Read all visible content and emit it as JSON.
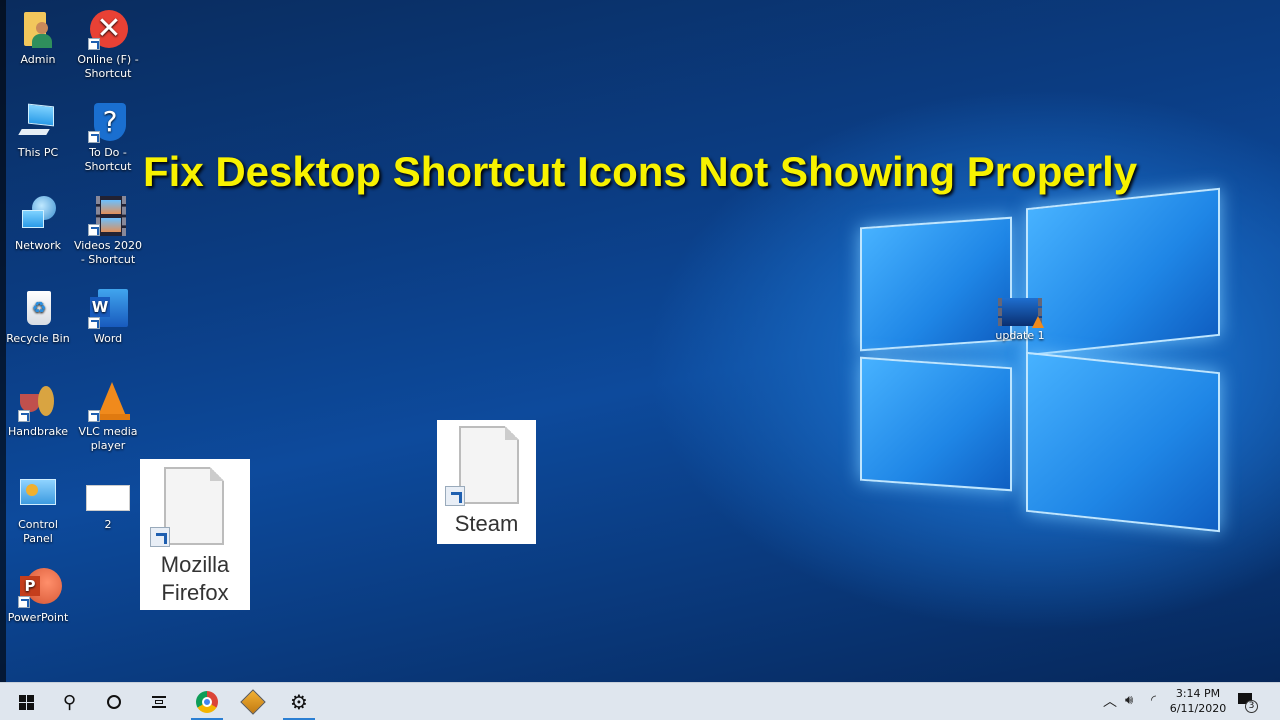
{
  "overlay_title": "Fix Desktop Shortcut Icons Not Showing Properly",
  "desktop_icons": [
    {
      "label": "Admin",
      "icon": "user-folder-icon",
      "shortcut": false
    },
    {
      "label": "Online (F) - Shortcut",
      "icon": "error-x-icon",
      "shortcut": true
    },
    {
      "label": "This PC",
      "icon": "computer-icon",
      "shortcut": false
    },
    {
      "label": "To Do - Shortcut",
      "icon": "question-shield-icon",
      "shortcut": true
    },
    {
      "label": "Network",
      "icon": "network-icon",
      "shortcut": false
    },
    {
      "label": "Videos 2020 - Shortcut",
      "icon": "film-strip-icon",
      "shortcut": true
    },
    {
      "label": "Recycle Bin",
      "icon": "recycle-bin-icon",
      "shortcut": false
    },
    {
      "label": "Word",
      "icon": "word-icon",
      "shortcut": true
    },
    {
      "label": "Handbrake",
      "icon": "handbrake-icon",
      "shortcut": true
    },
    {
      "label": "VLC media player",
      "icon": "vlc-cone-icon",
      "shortcut": true
    },
    {
      "label": "Control Panel",
      "icon": "control-panel-icon",
      "shortcut": false
    },
    {
      "label": "2",
      "icon": "image-thumbnail-icon",
      "shortcut": false
    },
    {
      "label": "PowerPoint",
      "icon": "powerpoint-icon",
      "shortcut": true
    },
    {
      "label": "update 1",
      "icon": "video-thumbnail-icon",
      "shortcut": false
    }
  ],
  "broken_shortcuts": [
    {
      "label": "Mozilla Firefox",
      "line1": "Mozilla",
      "line2": "Firefox",
      "icon": "blank-document-icon"
    },
    {
      "label": "Steam",
      "icon": "blank-document-icon"
    }
  ],
  "taskbar": {
    "start": "windows-logo-icon",
    "search": "search-icon",
    "cortana": "cortana-circle-icon",
    "task_view": "task-view-icon",
    "apps": [
      {
        "name": "Google Chrome",
        "icon": "chrome-icon",
        "active": true
      },
      {
        "name": "Winamp",
        "icon": "winamp-icon",
        "active": false
      },
      {
        "name": "Settings",
        "icon": "gear-icon",
        "active": true
      }
    ]
  },
  "tray": {
    "time": "3:14 PM",
    "date": "6/11/2020",
    "notification_count": "3"
  },
  "colors": {
    "title": "#f8f200",
    "taskbar": "#dfe6ee",
    "accent": "#2b7fd3"
  }
}
